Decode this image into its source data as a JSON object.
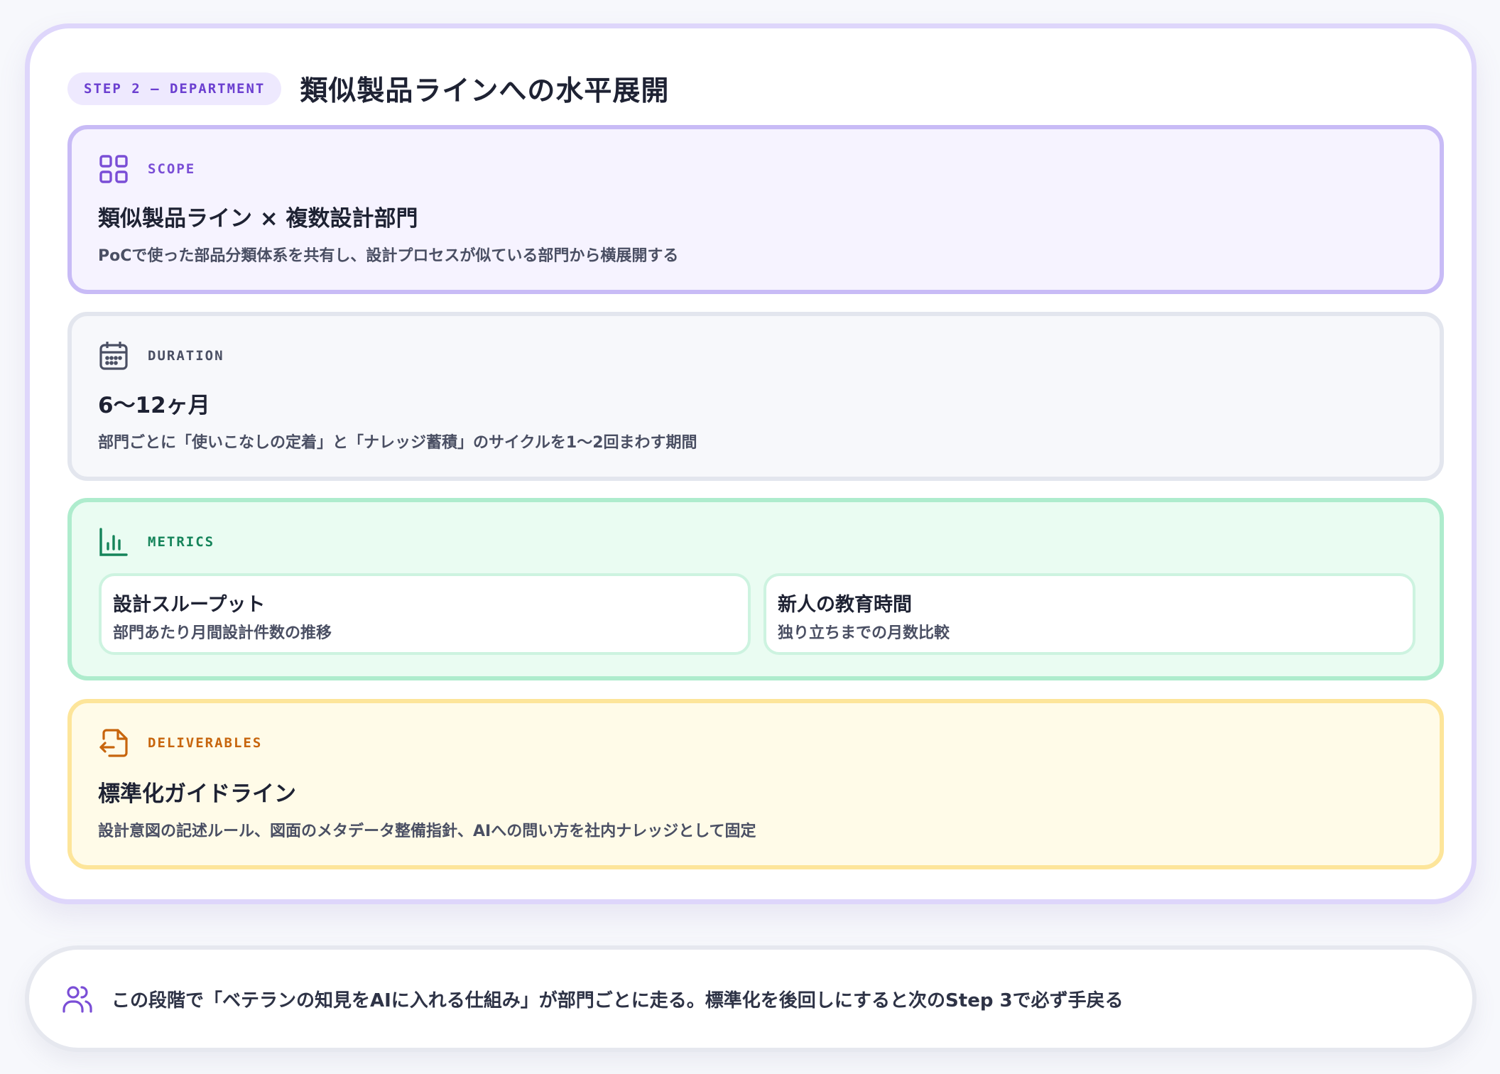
{
  "header": {
    "step_label": "STEP 2 — DEPARTMENT",
    "title": "類似製品ラインへの水平展開"
  },
  "sections": {
    "scope": {
      "icon": "grid-icon",
      "label": "SCOPE",
      "title": "類似製品ライン × 複数設計部門",
      "desc": "PoCで使った部品分類体系を共有し、設計プロセスが似ている部門から横展開する"
    },
    "duration": {
      "icon": "calendar-icon",
      "label": "DURATION",
      "title": "6〜12ヶ月",
      "desc": "部門ごとに「使いこなしの定着」と「ナレッジ蓄積」のサイクルを1〜2回まわす期間"
    },
    "metrics": {
      "icon": "bar-chart-icon",
      "label": "METRICS",
      "items": [
        {
          "title": "設計スループット",
          "sub": "部門あたり月間設計件数の推移"
        },
        {
          "title": "新人の教育時間",
          "sub": "独り立ちまでの月数比較"
        }
      ]
    },
    "deliverables": {
      "icon": "file-export-icon",
      "label": "DELIVERABLES",
      "title": "標準化ガイドライン",
      "desc": "設計意図の記述ルール、図面のメタデータ整備指針、AIへの問い方を社内ナレッジとして固定"
    }
  },
  "note": {
    "icon": "users-icon",
    "text": "この段階で「ベテランの知見をAIに入れる仕組み」が部門ごとに走る。標準化を後回しにすると次のStep 3で必ず手戻る"
  },
  "colors": {
    "accent_purple": "#6b3fd0",
    "scope_border": "#c8bbf6",
    "metrics_green": "#15845a",
    "deliverables_amber": "#c7650d",
    "duration_gray": "#4a4f63"
  }
}
